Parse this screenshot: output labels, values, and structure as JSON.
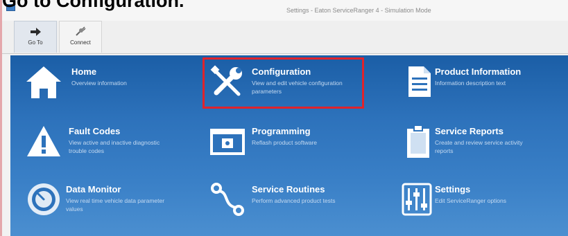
{
  "caption": "Go to Configuration.",
  "window": {
    "title": "Settings - Eaton ServiceRanger 4 - Simulation Mode"
  },
  "ribbon": {
    "buttons": [
      {
        "label": "Go To",
        "icon": "arrow-right-icon"
      },
      {
        "label": "Connect",
        "icon": "plug-icon"
      }
    ]
  },
  "tiles": [
    {
      "title": "Home",
      "desc": "Overview information",
      "icon": "home-icon"
    },
    {
      "title": "Configuration",
      "desc": "View and edit vehicle configuration parameters",
      "icon": "wrench-screwdriver-icon"
    },
    {
      "title": "Product Information",
      "desc": "Information description text",
      "icon": "document-icon"
    },
    {
      "title": "Fault Codes",
      "desc": "View active and inactive diagnostic trouble codes",
      "icon": "warning-icon"
    },
    {
      "title": "Programming",
      "desc": "Reflash product software",
      "icon": "programming-window-icon"
    },
    {
      "title": "Service Reports",
      "desc": "Create and review service activity reports",
      "icon": "clipboard-icon"
    },
    {
      "title": "Data Monitor",
      "desc": "View real time vehicle data parameter values",
      "icon": "gauge-icon"
    },
    {
      "title": "Service Routines",
      "desc": "Perform advanced product tests",
      "icon": "routine-icon"
    },
    {
      "title": "Settings",
      "desc": "Edit ServiceRanger options",
      "icon": "sliders-icon"
    }
  ],
  "colors": {
    "panel": "#2d72bb",
    "highlight": "#e0232b",
    "tile_title": "#ffffff",
    "tile_desc": "#c5daf1"
  }
}
